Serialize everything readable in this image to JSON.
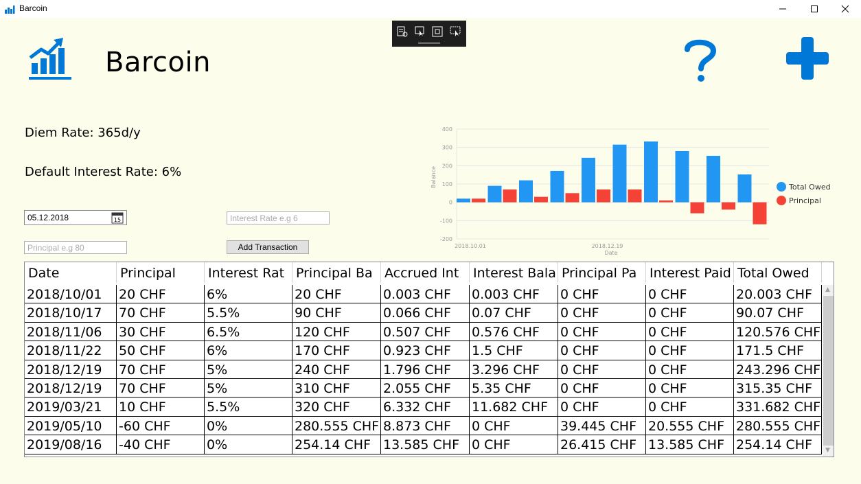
{
  "window": {
    "title": "Barcoin"
  },
  "header": {
    "app_name": "Barcoin"
  },
  "info": {
    "diem_rate": "Diem Rate: 365d/y",
    "default_interest_rate": "Default Interest Rate: 6%"
  },
  "form": {
    "date_value": "05.12.2018",
    "interest_placeholder": "Interest Rate e.g 6",
    "principal_placeholder": "Principal e.g 80",
    "add_button": "Add Transaction"
  },
  "colors": {
    "accent": "#0078d7",
    "total_owed": "#2196f3",
    "principal": "#f44336",
    "background": "#fdfdec"
  },
  "icons": [
    "app-chart-icon",
    "help-icon",
    "add-icon",
    "calendar-icon",
    "minimize-icon",
    "maximize-icon",
    "close-icon"
  ],
  "table": {
    "columns": [
      "Date",
      "Principal",
      "Interest Rat",
      "Principal Ba",
      "Accrued Int",
      "Interest Bala",
      "Principal Pa",
      "Interest Paid",
      "Total Owed"
    ],
    "rows": [
      [
        "2018/10/01",
        "20 CHF",
        "6%",
        "20 CHF",
        "0.003 CHF",
        "0.003 CHF",
        "0 CHF",
        "0 CHF",
        "20.003 CHF"
      ],
      [
        "2018/10/17",
        "70 CHF",
        "5.5%",
        "90 CHF",
        "0.066 CHF",
        "0.07 CHF",
        "0 CHF",
        "0 CHF",
        "90.07 CHF"
      ],
      [
        "2018/11/06",
        "30 CHF",
        "6.5%",
        "120 CHF",
        "0.507 CHF",
        "0.576 CHF",
        "0 CHF",
        "0 CHF",
        "120.576 CHF"
      ],
      [
        "2018/11/22",
        "50 CHF",
        "6%",
        "170 CHF",
        "0.923 CHF",
        "1.5 CHF",
        "0 CHF",
        "0 CHF",
        "171.5 CHF"
      ],
      [
        "2018/12/19",
        "70 CHF",
        "5%",
        "240 CHF",
        "1.796 CHF",
        "3.296 CHF",
        "0 CHF",
        "0 CHF",
        "243.296 CHF"
      ],
      [
        "2018/12/19",
        "70 CHF",
        "5%",
        "310 CHF",
        "2.055 CHF",
        "5.35 CHF",
        "0 CHF",
        "0 CHF",
        "315.35 CHF"
      ],
      [
        "2019/03/21",
        "10 CHF",
        "5.5%",
        "320 CHF",
        "6.332 CHF",
        "11.682 CHF",
        "0 CHF",
        "0 CHF",
        "331.682 CHF"
      ],
      [
        "2019/05/10",
        "-60 CHF",
        "0%",
        "280.555 CHF",
        "8.873 CHF",
        "0 CHF",
        "39.445 CHF",
        "20.555 CHF",
        "280.555 CHF"
      ],
      [
        "2019/08/16",
        "-40 CHF",
        "0%",
        "254.14 CHF",
        "13.585 CHF",
        "0 CHF",
        "26.415 CHF",
        "13.585 CHF",
        "254.14 CHF"
      ]
    ]
  },
  "chart_data": {
    "type": "bar",
    "xlabel": "Date",
    "ylabel": "Balance",
    "ylim": [
      -200,
      400
    ],
    "yticks": [
      -200,
      -100,
      0,
      100,
      200,
      300,
      400
    ],
    "xtick_labels": [
      "2018.10.01",
      "2018.12.19"
    ],
    "categories": [
      "2018/10/01",
      "2018/10/17",
      "2018/11/06",
      "2018/11/22",
      "2018/12/19",
      "2018/12/19",
      "2019/03/21",
      "2019/05/10",
      "2019/08/16",
      ""
    ],
    "series": [
      {
        "name": "Total Owed",
        "color": "#2196f3",
        "values": [
          20,
          90,
          120,
          171.5,
          243,
          315,
          332,
          280,
          254,
          152
        ]
      },
      {
        "name": "Principal",
        "color": "#f44336",
        "values": [
          20,
          70,
          30,
          50,
          70,
          70,
          10,
          -60,
          -40,
          -120
        ]
      }
    ],
    "legend": "right",
    "grid": true
  }
}
